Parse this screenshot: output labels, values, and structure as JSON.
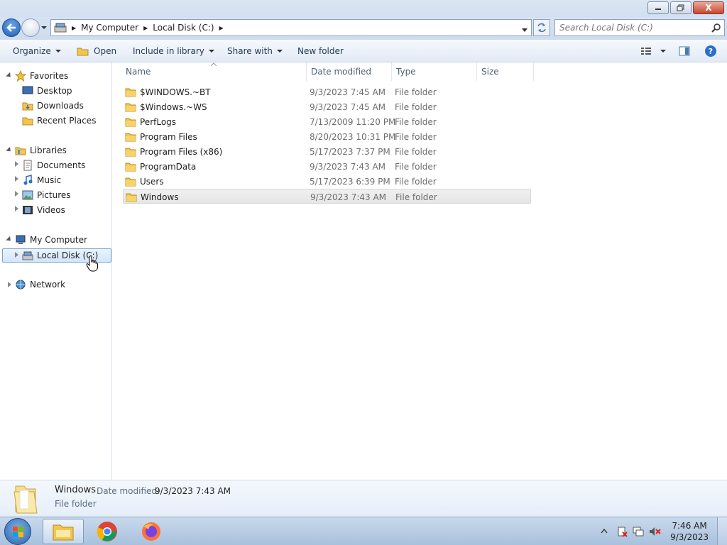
{
  "window": {
    "minimize_label": "Minimize",
    "restore_label": "Restore",
    "close_label": "X"
  },
  "address": {
    "crumbs": [
      "My Computer",
      "Local Disk (C:)"
    ]
  },
  "search": {
    "placeholder": "Search Local Disk (C:)"
  },
  "toolbar": {
    "organize": "Organize",
    "open": "Open",
    "include": "Include in library",
    "share": "Share with",
    "new_folder": "New folder"
  },
  "nav": {
    "favorites": "Favorites",
    "desktop": "Desktop",
    "downloads": "Downloads",
    "recent": "Recent Places",
    "libraries": "Libraries",
    "documents": "Documents",
    "music": "Music",
    "pictures": "Pictures",
    "videos": "Videos",
    "computer": "My Computer",
    "localdisk": "Local Disk (C:)",
    "network": "Network"
  },
  "columns": {
    "name": "Name",
    "date": "Date modified",
    "type": "Type",
    "size": "Size"
  },
  "files": [
    {
      "name": "$WINDOWS.~BT",
      "date": "9/3/2023 7:45 AM",
      "type": "File folder"
    },
    {
      "name": "$Windows.~WS",
      "date": "9/3/2023 7:45 AM",
      "type": "File folder"
    },
    {
      "name": "PerfLogs",
      "date": "7/13/2009 11:20 PM",
      "type": "File folder"
    },
    {
      "name": "Program Files",
      "date": "8/20/2023 10:31 PM",
      "type": "File folder"
    },
    {
      "name": "Program Files (x86)",
      "date": "5/17/2023 7:37 PM",
      "type": "File folder"
    },
    {
      "name": "ProgramData",
      "date": "9/3/2023 7:43 AM",
      "type": "File folder"
    },
    {
      "name": "Users",
      "date": "5/17/2023 6:39 PM",
      "type": "File folder"
    },
    {
      "name": "Windows",
      "date": "9/3/2023 7:43 AM",
      "type": "File folder"
    }
  ],
  "details": {
    "name": "Windows",
    "date_label": "Date modified:",
    "date_value": "9/3/2023 7:43 AM",
    "type": "File folder"
  },
  "taskbar": {
    "time": "7:46 AM",
    "date": "9/3/2023"
  },
  "colors": {
    "accent": "#1e395b",
    "folder": "#f2c64e",
    "selection": "#d3e6fb"
  }
}
